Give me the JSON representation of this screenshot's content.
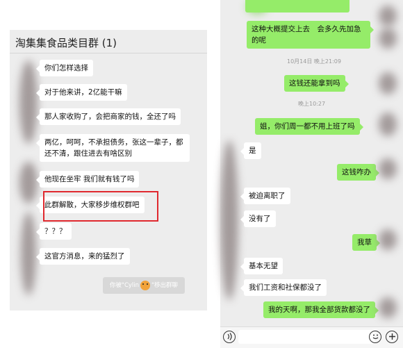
{
  "left_chat": {
    "title": "淘集集食品类目群 (1)",
    "messages": [
      "你们怎样选择",
      "对于他来讲，2亿能干嘛",
      "那人家收购了，会把商家的钱，全还了吗",
      "两亿，呵呵，不承担债务，张这一辈子，都还不清，跟住进去有啥区别",
      "他现在坐牢 我们就有钱了吗",
      "此群解散，大家移步维权群吧",
      "？？？",
      "这官方消息，来的猛烈了"
    ],
    "system_message": {
      "prefix": "你被\"Cylin",
      "suffix": "\"移出群聊"
    }
  },
  "right_chat": {
    "messages": [
      {
        "side": "right",
        "text": "这种大概提交上去　会多久先加急的呢"
      },
      {
        "side": "center",
        "text": "10月14日 晚上21:09"
      },
      {
        "side": "right",
        "text": "这钱还能拿到吗"
      },
      {
        "side": "center",
        "text": "晚上10:27"
      },
      {
        "side": "right",
        "text": "姐，你们周一都不用上班了吗"
      },
      {
        "side": "left",
        "text": "是"
      },
      {
        "side": "right",
        "text": "这钱咋办"
      },
      {
        "side": "left",
        "text": "被迫离职了"
      },
      {
        "side": "left",
        "text": "没有了"
      },
      {
        "side": "right",
        "text": "我草"
      },
      {
        "side": "left",
        "text": "基本无望"
      },
      {
        "side": "left",
        "text": "我们工资和社保都没了"
      },
      {
        "side": "right",
        "text": "我的天啊，那我全部货款都没了"
      }
    ],
    "icons": [
      "voice-icon",
      "emoji-icon",
      "plus-icon"
    ]
  }
}
